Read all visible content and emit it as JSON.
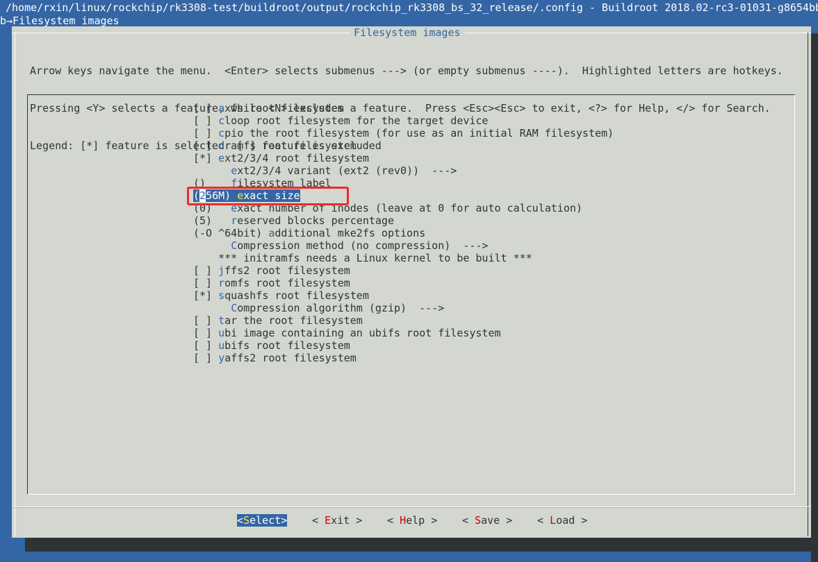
{
  "terminal": {
    "title": "/home/rxin/linux/rockchip/rk3308-test/buildroot/output/rockchip_rk3308_bs_32_release/.config - Buildroot 2018.02-rc3-01031-g8654bb",
    "breadcrumb": "b→Filesystem images"
  },
  "dialog": {
    "title": "Filesystem images",
    "help_lines": [
      "Arrow keys navigate the menu.  <Enter> selects submenus ---> (or empty submenus ----).  Highlighted letters are hotkeys.",
      "Pressing <Y> selects a feature, while <N> excludes a feature.  Press <Esc><Esc> to exit, <?> for Help, </> for Search.",
      "Legend: [*] feature is selected  [ ] feature is excluded"
    ]
  },
  "menu": {
    "items": [
      {
        "p": "[ ] ",
        "h": "a",
        "t": "xfs root filesystem"
      },
      {
        "p": "[ ] ",
        "h": "c",
        "t": "loop root filesystem for the target device"
      },
      {
        "p": "[ ] ",
        "h": "c",
        "t": "pio the root filesystem (for use as an initial RAM filesystem)"
      },
      {
        "p": "[ ] ",
        "h": "c",
        "t": "ramfs root filesystem"
      },
      {
        "p": "[*] ",
        "h": "e",
        "t": "xt2/3/4 root filesystem"
      },
      {
        "p": "      ",
        "h": "e",
        "t": "xt2/3/4 variant (ext2 (rev0))  --->"
      },
      {
        "p": "()    ",
        "h": "f",
        "t": "ilesystem label"
      },
      {
        "p": "(256M) ",
        "h": "e",
        "t": "xact size"
      },
      {
        "p": "(0)   ",
        "h": "e",
        "t": "xact number of inodes (leave at 0 for auto calculation)"
      },
      {
        "p": "(5)   ",
        "h": "r",
        "t": "eserved blocks percentage"
      },
      {
        "p": "(-O ^64bit) ",
        "h": "a",
        "t": "dditional mke2fs options"
      },
      {
        "p": "      ",
        "h": "C",
        "t": "ompression method (no compression)  --->"
      },
      {
        "p": "    ",
        "h": "",
        "t": "*** initramfs needs a Linux kernel to be built ***"
      },
      {
        "p": "[ ] ",
        "h": "j",
        "t": "ffs2 root filesystem"
      },
      {
        "p": "[ ] ",
        "h": "r",
        "t": "omfs root filesystem"
      },
      {
        "p": "[*] ",
        "h": "s",
        "t": "quashfs root filesystem"
      },
      {
        "p": "      ",
        "h": "C",
        "t": "ompression algorithm (gzip)  --->"
      },
      {
        "p": "[ ] ",
        "h": "t",
        "t": "ar the root filesystem"
      },
      {
        "p": "[ ] ",
        "h": "u",
        "t": "bi image containing an ubifs root filesystem"
      },
      {
        "p": "[ ] ",
        "h": "u",
        "t": "bifs root filesystem"
      },
      {
        "p": "[ ] ",
        "h": "y",
        "t": "affs2 root filesystem"
      }
    ],
    "selected_index": 7
  },
  "buttons": [
    {
      "pre": "<",
      "hk": "S",
      "post": "elect>",
      "active": true
    },
    {
      "pre": "< ",
      "hk": "E",
      "post": "xit >",
      "active": false
    },
    {
      "pre": "< ",
      "hk": "H",
      "post": "elp >",
      "active": false
    },
    {
      "pre": "< ",
      "hk": "S",
      "post": "ave >",
      "active": false
    },
    {
      "pre": "< ",
      "hk": "L",
      "post": "oad >",
      "active": false
    }
  ],
  "colors": {
    "background": "#3465a4",
    "dialog": "#d3d7cf",
    "highlight": "#ef2929",
    "hotkey": "#3465a4"
  }
}
